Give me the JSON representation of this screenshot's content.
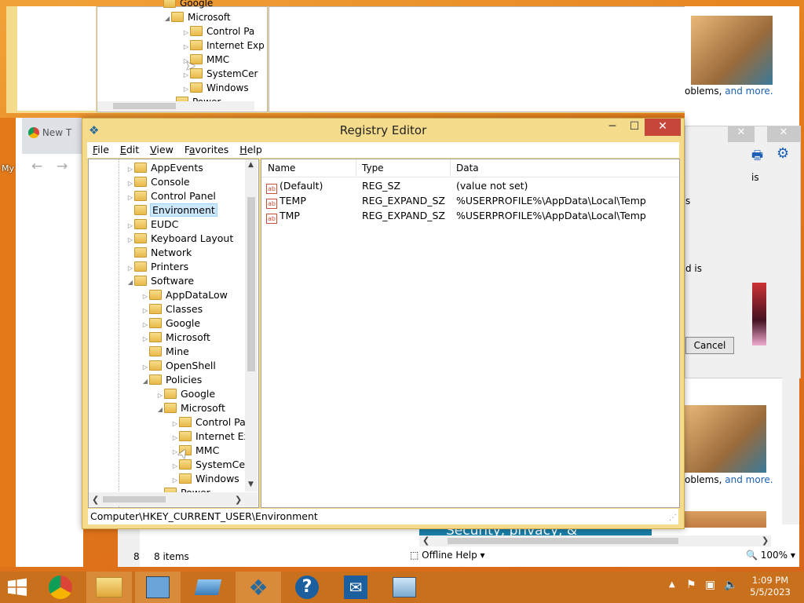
{
  "bg_regedit": {
    "items": [
      "Google",
      "Microsoft",
      "Control Pa",
      "Internet Exp",
      "MMC",
      "SystemCer",
      "Windows",
      "Power"
    ]
  },
  "help_window": {
    "text_problems": "oblems,",
    "link_more": "and more.",
    "text_problems2": "oblems,",
    "link_more2": "and more.",
    "banner": "Security, privacy, &",
    "offline_help": "Offline Help",
    "zoom": "100%",
    "frag_is": "is",
    "frag_s": "s",
    "frag_d_is": "d is",
    "cancel": "Cancel"
  },
  "browser": {
    "tab_label": "New T",
    "desktop_icon_label": "My"
  },
  "explorer_behind": {
    "items_count": "8 items",
    "frag8": "8"
  },
  "regedit": {
    "title": "Registry Editor",
    "menu": [
      "File",
      "Edit",
      "View",
      "Favorites",
      "Help"
    ],
    "tree": [
      {
        "label": "AppEvents",
        "depth": 0,
        "expander": true
      },
      {
        "label": "Console",
        "depth": 0,
        "expander": true
      },
      {
        "label": "Control Panel",
        "depth": 0,
        "expander": true
      },
      {
        "label": "Environment",
        "depth": 0,
        "expander": false,
        "selected": true
      },
      {
        "label": "EUDC",
        "depth": 0,
        "expander": true
      },
      {
        "label": "Keyboard Layout",
        "depth": 0,
        "expander": true
      },
      {
        "label": "Network",
        "depth": 0,
        "expander": false
      },
      {
        "label": "Printers",
        "depth": 0,
        "expander": true
      },
      {
        "label": "Software",
        "depth": 0,
        "expander": "open"
      },
      {
        "label": "AppDataLow",
        "depth": 1,
        "expander": true
      },
      {
        "label": "Classes",
        "depth": 1,
        "expander": true
      },
      {
        "label": "Google",
        "depth": 1,
        "expander": true
      },
      {
        "label": "Microsoft",
        "depth": 1,
        "expander": true
      },
      {
        "label": "Mine",
        "depth": 1,
        "expander": false
      },
      {
        "label": "OpenShell",
        "depth": 1,
        "expander": true
      },
      {
        "label": "Policies",
        "depth": 1,
        "expander": "open"
      },
      {
        "label": "Google",
        "depth": 2,
        "expander": true
      },
      {
        "label": "Microsoft",
        "depth": 2,
        "expander": "open"
      },
      {
        "label": "Control Pa",
        "depth": 3,
        "expander": true
      },
      {
        "label": "Internet Exp",
        "depth": 3,
        "expander": true
      },
      {
        "label": "MMC",
        "depth": 3,
        "expander": true
      },
      {
        "label": "SystemCer",
        "depth": 3,
        "expander": true
      },
      {
        "label": "Windows",
        "depth": 3,
        "expander": true
      },
      {
        "label": "Power",
        "depth": 2,
        "expander": true
      }
    ],
    "columns": [
      "Name",
      "Type",
      "Data"
    ],
    "values": [
      {
        "name": "(Default)",
        "type": "REG_SZ",
        "data": "(value not set)"
      },
      {
        "name": "TEMP",
        "type": "REG_EXPAND_SZ",
        "data": "%USERPROFILE%\\AppData\\Local\\Temp"
      },
      {
        "name": "TMP",
        "type": "REG_EXPAND_SZ",
        "data": "%USERPROFILE%\\AppData\\Local\\Temp"
      }
    ],
    "status_path": "Computer\\HKEY_CURRENT_USER\\Environment"
  },
  "taskbar": {
    "apps": [
      "chrome-icon",
      "file-explorer-icon",
      "control-panel-icon",
      "remote-desktop-icon",
      "registry-editor-icon",
      "help-icon",
      "mail-icon",
      "network-icon"
    ],
    "time": "1:09 PM",
    "date": "5/5/2023"
  }
}
